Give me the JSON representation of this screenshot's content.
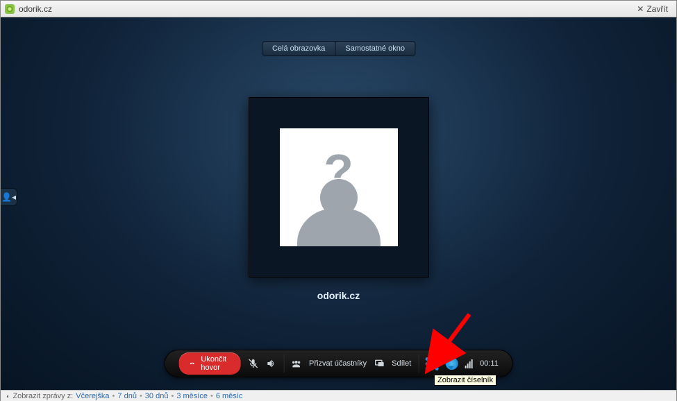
{
  "window": {
    "title": "odorik.cz",
    "close_label": "Zavřít"
  },
  "top_controls": {
    "fullscreen_label": "Celá obrazovka",
    "popout_label": "Samostatné okno"
  },
  "contact": {
    "name": "odorik.cz"
  },
  "call_bar": {
    "end_call_label": "Ukončit hovor",
    "invite_label": "Přizvat účastníky",
    "share_label": "Sdílet",
    "duration": "00:11"
  },
  "tooltip": {
    "dialpad": "Zobrazit číselník"
  },
  "footer": {
    "prefix": "Zobrazit zprávy z:",
    "items": [
      "Včerejška",
      "7 dnů",
      "30 dnů",
      "3 měsíce",
      "6 měsíc"
    ]
  },
  "icons": {
    "status": "status-online-icon",
    "close": "close-icon",
    "mic_mute": "mic-mute-icon",
    "volume": "volume-icon",
    "group": "group-icon",
    "share_screen": "share-screen-icon",
    "dialpad": "dialpad-icon",
    "chat": "chat-icon",
    "signal": "signal-icon",
    "expand_side": "expand-side-icon"
  }
}
